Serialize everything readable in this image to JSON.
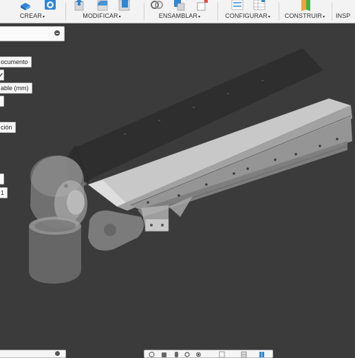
{
  "toolbar": {
    "groups": [
      {
        "label": "CREAR",
        "icons": [
          "extrude-icon",
          "revolve-icon"
        ]
      },
      {
        "label": "MODIFICAR",
        "icons": [
          "press-pull-icon",
          "fillet-icon",
          "shell-icon"
        ]
      },
      {
        "label": "ENSAMBLAR",
        "icons": [
          "joint-icon",
          "new-component-icon",
          "as-built-joint-icon"
        ]
      },
      {
        "label": "CONFIGURAR",
        "icons": [
          "change-parameters-icon",
          "configuration-table-icon"
        ]
      },
      {
        "label": "CONSTRUIR",
        "icons": [
          "offset-plane-icon"
        ]
      },
      {
        "label": "INSP"
      }
    ],
    "caret": "▾"
  },
  "browser": {
    "items": [
      {
        "label": "ocumento"
      },
      {
        "label": "able (mm)"
      },
      {
        "label": "ción"
      },
      {
        "label": "1"
      }
    ]
  },
  "navigation_bar": {
    "icons": [
      "orbit-icon",
      "look-at-icon",
      "pan-icon",
      "zoom-icon",
      "fit-icon",
      "display-settings-icon",
      "grid-settings-icon",
      "viewports-icon"
    ]
  },
  "colors": {
    "toolbar_bg": "#f3f3f3",
    "viewport_bg": "#3b3b3b",
    "model_gray": "#a9a9a9",
    "accent_blue": "#2f86d6"
  }
}
